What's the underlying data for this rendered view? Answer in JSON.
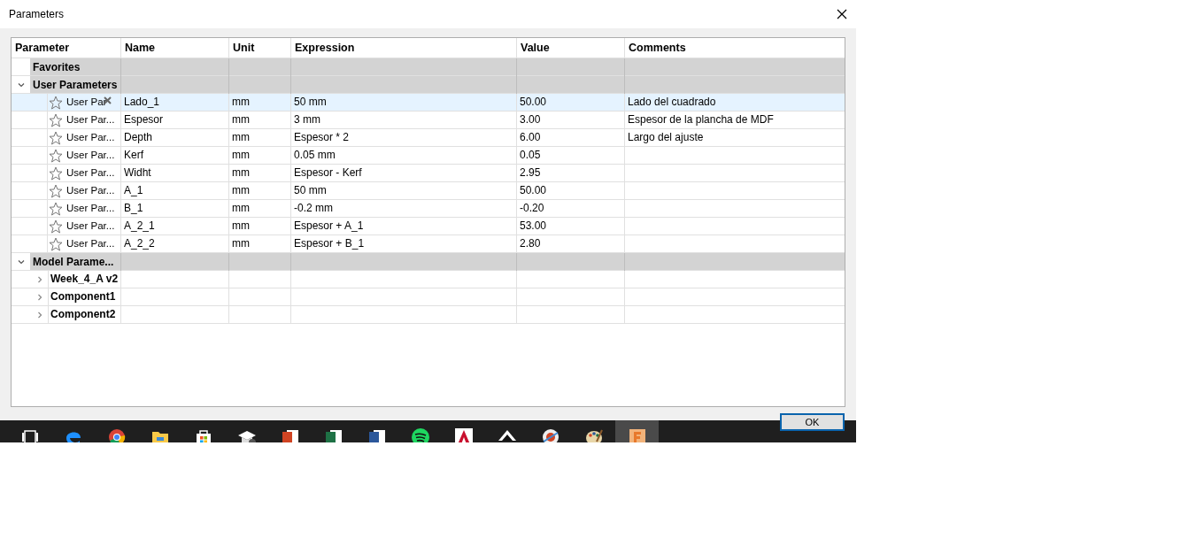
{
  "window": {
    "title": "Parameters"
  },
  "table": {
    "columns": [
      "Parameter",
      "Name",
      "Unit",
      "Expression",
      "Value",
      "Comments"
    ],
    "favorites": {
      "label": "Favorites"
    },
    "user_group": {
      "label": "User Parameters",
      "expanded": true,
      "rows": [
        {
          "parameter": "User Par",
          "name": "Lado_1",
          "unit": "mm",
          "expression": "50 mm",
          "value": "50.00",
          "comment": "Lado del cuadrado",
          "favorite": false,
          "selected": true,
          "delete_shown": true
        },
        {
          "parameter": "User Par...",
          "name": "Espesor",
          "unit": "mm",
          "expression": "3 mm",
          "value": "3.00",
          "comment": "Espesor de la plancha de MDF",
          "favorite": false,
          "selected": false,
          "delete_shown": false
        },
        {
          "parameter": "User Par...",
          "name": "Depth",
          "unit": "mm",
          "expression": "Espesor * 2",
          "value": "6.00",
          "comment": "Largo del ajuste",
          "favorite": false,
          "selected": false,
          "delete_shown": false
        },
        {
          "parameter": "User Par...",
          "name": "Kerf",
          "unit": "mm",
          "expression": "0.05 mm",
          "value": "0.05",
          "favorite": false,
          "selected": false,
          "delete_shown": false
        },
        {
          "parameter": "User Par...",
          "name": "Widht",
          "unit": "mm",
          "expression": "Espesor - Kerf",
          "value": "2.95",
          "favorite": false,
          "selected": false,
          "delete_shown": false
        },
        {
          "parameter": "User Par...",
          "name": "A_1",
          "unit": "mm",
          "expression": "50 mm",
          "value": "50.00",
          "favorite": false,
          "selected": false,
          "delete_shown": false
        },
        {
          "parameter": "User Par...",
          "name": "B_1",
          "unit": "mm",
          "expression": "-0.2 mm",
          "value": "-0.20",
          "favorite": false,
          "selected": false,
          "delete_shown": false
        },
        {
          "parameter": "User Par...",
          "name": "A_2_1",
          "unit": "mm",
          "expression": "Espesor + A_1",
          "value": "53.00",
          "favorite": false,
          "selected": false,
          "delete_shown": false
        },
        {
          "parameter": "User Par...",
          "name": "A_2_2",
          "unit": "mm",
          "expression": "Espesor + B_1",
          "value": "2.80",
          "favorite": false,
          "selected": false,
          "delete_shown": false
        }
      ]
    },
    "model_group": {
      "label": "Model Parame...",
      "expanded": true,
      "children": [
        {
          "label": "Week_4_A v2",
          "expanded": false
        },
        {
          "label": "Component1",
          "expanded": false
        },
        {
          "label": "Component2",
          "expanded": false
        }
      ]
    }
  },
  "ok_button": {
    "label": "OK"
  },
  "taskbar": [
    {
      "kind": "taskview",
      "selected": false
    },
    {
      "kind": "edge",
      "selected": false
    },
    {
      "kind": "chrome",
      "selected": false
    },
    {
      "kind": "folder",
      "selected": false
    },
    {
      "kind": "store",
      "selected": false
    },
    {
      "kind": "cap",
      "selected": false
    },
    {
      "kind": "doc_red",
      "selected": false
    },
    {
      "kind": "doc_green",
      "selected": false
    },
    {
      "kind": "doc_blue",
      "selected": false
    },
    {
      "kind": "spotify",
      "selected": false
    },
    {
      "kind": "triangle",
      "selected": false
    },
    {
      "kind": "mountain",
      "selected": false
    },
    {
      "kind": "ring",
      "selected": false
    },
    {
      "kind": "palette",
      "selected": false
    },
    {
      "kind": "square",
      "selected": true
    }
  ]
}
